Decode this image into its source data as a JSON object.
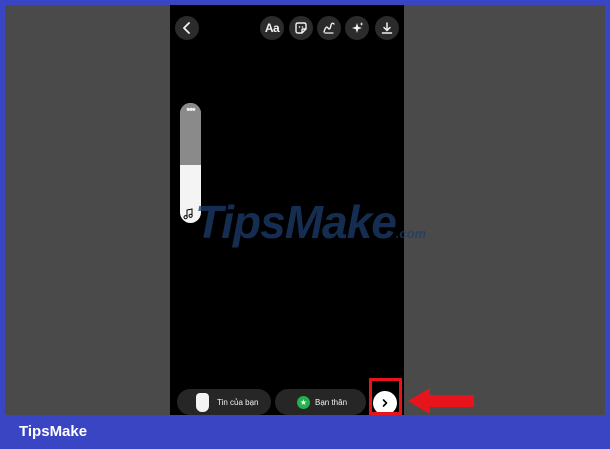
{
  "toolbar": {
    "text_label": "Aa",
    "icons": [
      "back-icon",
      "text-icon",
      "sticker-icon",
      "draw-icon",
      "effects-icon",
      "download-icon"
    ]
  },
  "slider": {
    "dots": "•••",
    "icon": "music-note-icon"
  },
  "watermark": {
    "text": "TipsMake",
    "suffix": ".com"
  },
  "share_bar": {
    "story_label": "Tin của bạn",
    "friends_label": "Bạn thân",
    "send_icon": "chevron-right-icon"
  },
  "colors": {
    "highlight": "#e8141b",
    "banner": "#3a45c4",
    "close_friends_green": "#22b14c"
  },
  "banner": {
    "brand": "TipsMake"
  }
}
